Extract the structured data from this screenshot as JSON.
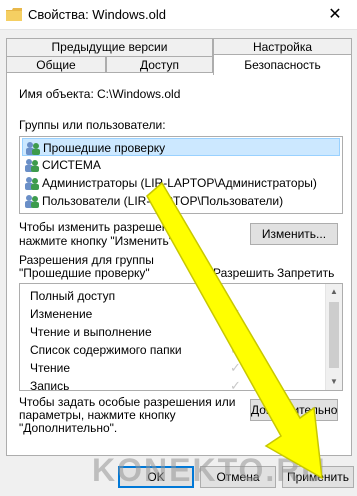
{
  "window": {
    "title": "Свойства: Windows.old",
    "close_glyph": "✕"
  },
  "tabs_row1": [
    "Предыдущие версии",
    "Настройка"
  ],
  "tabs_row2": [
    "Общие",
    "Доступ",
    "Безопасность"
  ],
  "active_tab": "Безопасность",
  "object": {
    "label": "Имя объекта:",
    "value": "C:\\Windows.old"
  },
  "groups": {
    "label": "Группы или пользователи:",
    "items": [
      "Прошедшие проверку",
      "СИСТЕМА",
      "Администраторы (LIR-LAPTOP\\Администраторы)",
      "Пользователи (LIR-LAPTOP\\Пользователи)"
    ],
    "selected_index": 0
  },
  "change_hint": {
    "line1": "Чтобы изменить разрешения,",
    "line2": "нажмите кнопку \"Изменить\"."
  },
  "edit_button": "Изменить...",
  "permissions": {
    "label_line1": "Разрешения для группы",
    "label_line2": "\"Прошедшие проверку\"",
    "allow_header": "Разрешить",
    "deny_header": "Запретить",
    "rows": [
      {
        "name": "Полный доступ",
        "allow": false
      },
      {
        "name": "Изменение",
        "allow": true
      },
      {
        "name": "Чтение и выполнение",
        "allow": true
      },
      {
        "name": "Список содержимого папки",
        "allow": true
      },
      {
        "name": "Чтение",
        "allow": true
      },
      {
        "name": "Запись",
        "allow": true
      }
    ]
  },
  "advanced_hint": {
    "line1": "Чтобы задать особые разрешения или",
    "line2": "параметры, нажмите кнопку",
    "line3": "\"Дополнительно\"."
  },
  "advanced_button": "Дополнительно",
  "footer": {
    "ok": "OK",
    "cancel": "Отмена",
    "apply": "Применить"
  },
  "watermark": "KONEKTO.RU",
  "colors": {
    "selection": "#cce8ff",
    "arrow": "#ffff00",
    "accent": "#0078d7"
  }
}
